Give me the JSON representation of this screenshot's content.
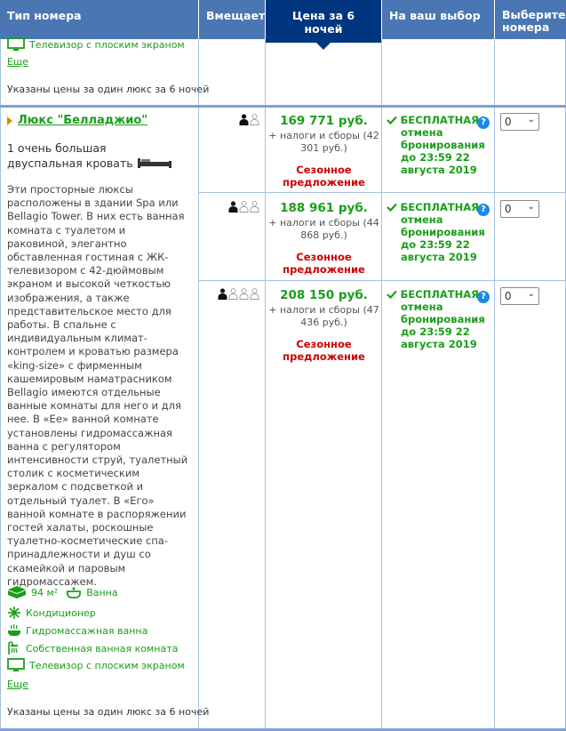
{
  "header": {
    "room_type": "Тип номера",
    "sleeps": "Вмещает",
    "price": "Цена за 6 ночей",
    "your_choice": "На ваш выбор",
    "select_rooms": "Выберите номера"
  },
  "prev_room": {
    "amenity_tv": "Телевизор с плоским экраном",
    "more_link": "Еще",
    "price_note": "Указаны цены за один люкс за 6 ночей"
  },
  "room": {
    "name": "Люкс \"Белладжио\"",
    "bed": "1 очень большая двуспальная кровать",
    "description": "Эти просторные люксы расположены в здании Spa или Bellagio Tower. В них есть ванная комната с туалетом и раковиной, элегантно обставленная гостиная с ЖК-телевизором с 42-дюймовым экраном и высокой четкостью изображения, а также представительское место для работы. В спальне с индивидуальным климат-контролем и кроватью размера «king-size» с фирменным кашемировым наматрасником Bellagio имеются отдельные ванные комнаты для него и для нее. В «Ее» ванной комнате установлены гидромассажная ванна с регулятором интенсивности струй, туалетный столик с косметическим зеркалом с подсветкой и отдельный туалет. В «Его» ванной комнате в распоряжении гостей халаты, роскошные туалетно-косметические спа-принадлежности и душ со скамейкой и паровым гидромассажем.",
    "amenities": {
      "size": "94 м²",
      "bath": "Ванна",
      "ac": "Кондиционер",
      "hydro": "Гидромассажная ванна",
      "private_bath": "Собственная ванная комната",
      "tv": "Телевизор с плоским экраном"
    },
    "more_link": "Еще",
    "price_note": "Указаны цены за один люкс за 6 ночей"
  },
  "options": [
    {
      "adults": 1,
      "price": "169 771 руб.",
      "taxes": "+ налоги и сборы (42 301 руб.)",
      "seasonal": "Сезонное предложение",
      "free": "БЕСПЛАТНАЯ",
      "cancel": "отмена бронирования до 23:59 22 августа 2019",
      "qty": "0"
    },
    {
      "adults": 2,
      "price": "188 961 руб.",
      "taxes": "+ налоги и сборы (44 868 руб.)",
      "seasonal": "Сезонное предложение",
      "free": "БЕСПЛАТНАЯ",
      "cancel": "отмена бронирования до 23:59 22 августа 2019",
      "qty": "0"
    },
    {
      "adults": 3,
      "price": "208 150 руб.",
      "taxes": "+ налоги и сборы (47 436 руб.)",
      "seasonal": "Сезонное предложение",
      "free": "БЕСПЛАТНАЯ",
      "cancel": "отмена бронирования до 23:59 22 августа 2019",
      "qty": "0"
    }
  ],
  "colors": {
    "header": "#4a76b3",
    "header_selected": "#003580",
    "green": "#1a9e1a",
    "red": "#cc0000",
    "border": "#a9c1e3"
  }
}
